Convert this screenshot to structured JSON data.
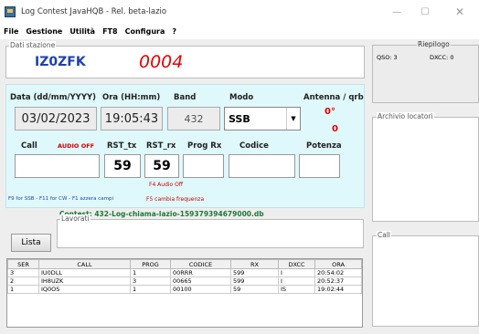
{
  "window": {
    "title": "Log Contest JavaHQB - Rel. beta-lazio",
    "minimize": "—",
    "maximize": "☐",
    "close": "✕"
  },
  "menu": [
    "File",
    "Gestione",
    "Utilità",
    "FT8",
    "Configura",
    "?"
  ],
  "station": {
    "group_title": "Dati stazione",
    "callsign": "IZ0ZFK",
    "qso_number": "0004"
  },
  "form": {
    "date_label": "Data (dd/mm/YYYY)",
    "date_value": "03/02/2023",
    "time_label": "Ora (HH:mm)",
    "time_value": "19:05:43",
    "band_label": "Band",
    "band_value": "432",
    "mode_label": "Modo",
    "mode_value": "SSB",
    "antenna_label": "Antenna / qrb",
    "antenna_value": "0°",
    "qrb_value": "0",
    "call_label": "Call",
    "audio_off": "AUDIO OFF",
    "rst_tx_label": "RST_tx",
    "rst_tx_value": "59",
    "rst_rx_label": "RST_rx",
    "rst_rx_value": "59",
    "prog_rx_label": "Prog Rx",
    "codice_label": "Codice",
    "potenza_label": "Potenza",
    "f4_hint": "F4 Audio Off",
    "keys_hint": "F9 for SSB - F11 for CW - F1 azzera campi",
    "f5_hint": "F5 cambia frequenza"
  },
  "contest_file": "Contest: 432-Log-chiama-lazio-159379394679000.db",
  "lavorati_title": "Lavorati",
  "lista_button": "Lista",
  "table": {
    "headers": [
      "SER",
      "CALL",
      "PROG",
      "CODICE",
      "RX",
      "DXCC",
      "ORA"
    ],
    "rows": [
      [
        "3",
        "IU0DLL",
        "1",
        "00RRR",
        "599",
        "I",
        "20:54:02"
      ],
      [
        "2",
        "IH8UZK",
        "3",
        "00665",
        "599",
        "I",
        "20:52:37"
      ],
      [
        "1",
        "IQ0OS",
        "1",
        "00100",
        "59",
        "IS",
        "19:02:44"
      ]
    ]
  },
  "riepilogo": {
    "title": "Riepilogo",
    "qso": "QSO: 3",
    "dxcc": "DXCC:  0"
  },
  "archivio_title": "Archivio locatori",
  "call_panel_title": "Call"
}
